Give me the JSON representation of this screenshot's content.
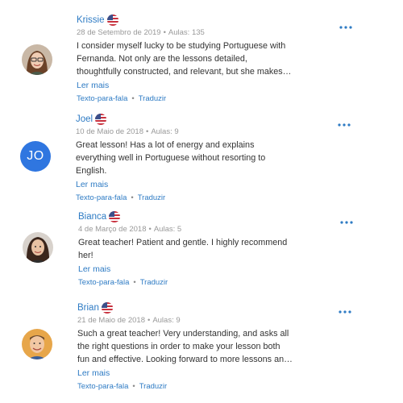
{
  "colors": {
    "accent": "#2e7bc4",
    "meta": "#999999",
    "avatar_initials_bg": "#2f76e0"
  },
  "icons": {
    "menu": "more-horizontal-icon",
    "flag": "us-flag-icon"
  },
  "ui": {
    "read_more": "Ler mais",
    "text_to_speech": "Texto-para-fala",
    "translate": "Traduzir",
    "separator": "•"
  },
  "reviews": [
    {
      "name": "Krissie",
      "date": "28 de Setembro de 2019",
      "lessons": "Aulas: 135",
      "text_lines": [
        "I consider myself lucky to be studying Portuguese with",
        "Fernanda. Not only are the lessons detailed,",
        "thoughtfully constructed, and relevant, but she makes…"
      ]
    },
    {
      "name": "Joel",
      "initials": "JO",
      "date": "10 de Maio de 2018",
      "lessons": "Aulas: 9",
      "text_lines": [
        "Great lesson! Has a lot of energy and explains",
        "everything well in Portuguese without resorting to",
        "English."
      ]
    },
    {
      "name": "Bianca",
      "date": "4 de Março de 2018",
      "lessons": "Aulas: 5",
      "text_lines": [
        "Great teacher! Patient and gentle. I highly recommend",
        "her!"
      ]
    },
    {
      "name": "Brian",
      "date": "21 de Maio de 2018",
      "lessons": "Aulas: 9",
      "text_lines": [
        "Such a great teacher! Very understanding, and asks all",
        "the right questions in order to make your lesson both",
        "fun and effective. Looking forward to more lessons an…"
      ]
    }
  ]
}
